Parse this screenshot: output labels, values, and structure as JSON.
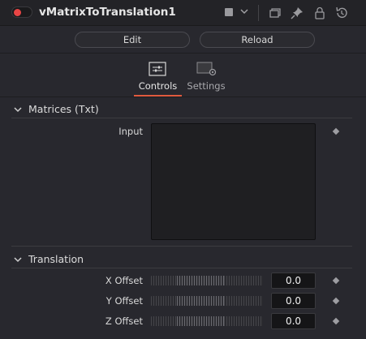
{
  "header": {
    "node_name": "vMatrixToTranslation1",
    "enabled": true,
    "accent_color": "#e84545",
    "icons": [
      "color-swatch",
      "chevron-down-icon",
      "versions-icon",
      "pin-icon",
      "lock-icon",
      "reset-icon"
    ]
  },
  "actions": {
    "edit_label": "Edit",
    "reload_label": "Reload"
  },
  "tabs": [
    {
      "label": "Controls",
      "icon": "sliders-icon",
      "active": true
    },
    {
      "label": "Settings",
      "icon": "settings-icon",
      "active": false
    }
  ],
  "tab_accent_color": "#e05a3e",
  "sections": {
    "matrices": {
      "title": "Matrices (Txt)",
      "input_label": "Input"
    },
    "translation": {
      "title": "Translation",
      "params": [
        {
          "label": "X Offset",
          "value": "0.0"
        },
        {
          "label": "Y Offset",
          "value": "0.0"
        },
        {
          "label": "Z Offset",
          "value": "0.0"
        }
      ]
    }
  }
}
